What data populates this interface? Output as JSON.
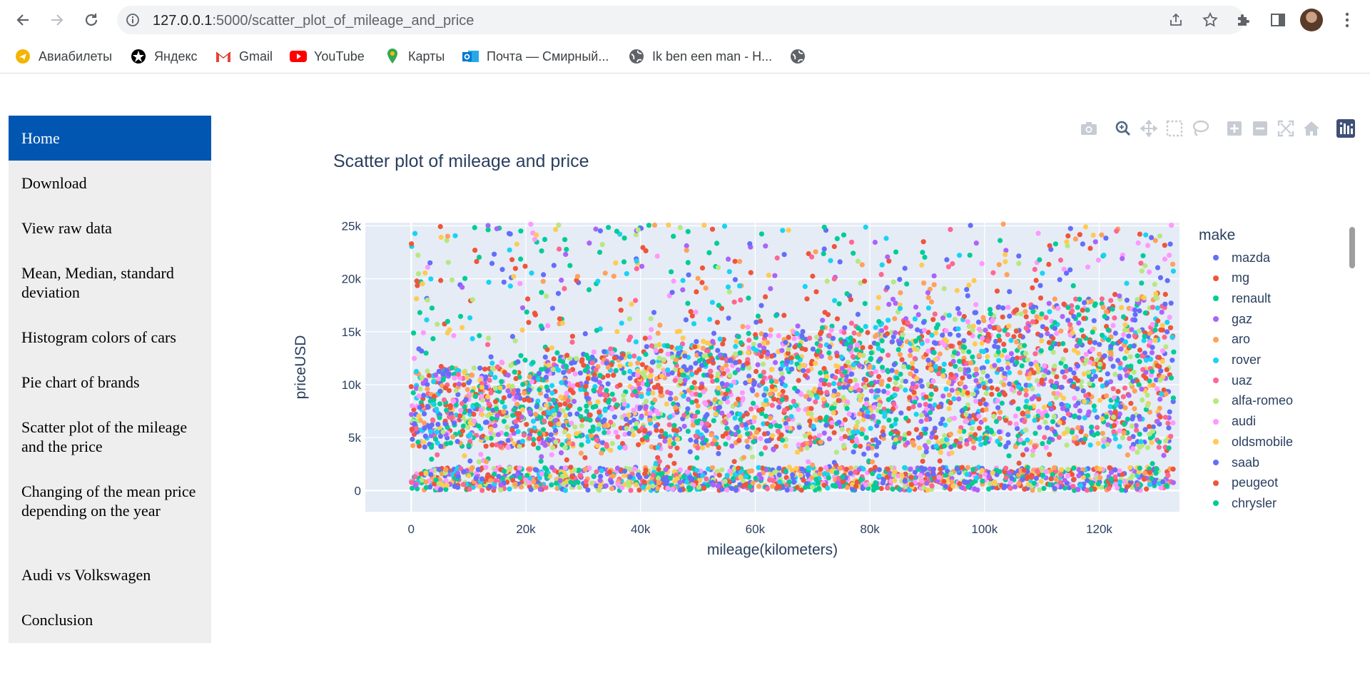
{
  "browser": {
    "url_host": "127.0.0.1",
    "url_path": ":5000/scatter_plot_of_mileage_and_price",
    "bookmarks": [
      {
        "label": "Авиабилеты",
        "icon": "plane-bookmark-icon",
        "color": "#f4b400"
      },
      {
        "label": "Яндекс",
        "icon": "yandex-icon",
        "color": "#000000"
      },
      {
        "label": "Gmail",
        "icon": "gmail-icon",
        "color": "#ea4335"
      },
      {
        "label": "YouTube",
        "icon": "youtube-icon",
        "color": "#ff0000"
      },
      {
        "label": "Карты",
        "icon": "maps-icon",
        "color": "#34a853"
      },
      {
        "label": "Почта — Смирный...",
        "icon": "outlook-icon",
        "color": "#0078d4"
      },
      {
        "label": "Ik ben een man - H...",
        "icon": "globe-icon",
        "color": "#5f6368"
      },
      {
        "label": "",
        "icon": "globe-icon",
        "color": "#5f6368"
      }
    ]
  },
  "sidebar": {
    "items": [
      {
        "label": "Home",
        "active": true
      },
      {
        "label": "Download",
        "active": false
      },
      {
        "label": "View raw data",
        "active": false
      },
      {
        "label": "Mean, Median, standard deviation",
        "active": false
      },
      {
        "label": "Histogram colors of cars",
        "active": false
      },
      {
        "label": "Pie chart of brands",
        "active": false
      },
      {
        "label": "Scatter plot of the mileage and the price",
        "active": false
      },
      {
        "label": "Changing of the mean price depending on the year",
        "active": false
      },
      {
        "label": "Audi vs Volkswagen",
        "active": false
      },
      {
        "label": "Conclusion",
        "active": false
      }
    ]
  },
  "modebar": [
    "camera-icon",
    "zoom-icon",
    "pan-icon",
    "box-select-icon",
    "lasso-select-icon",
    "zoom-in-icon",
    "zoom-out-icon",
    "autoscale-icon",
    "reset-axes-icon",
    "plotly-logo-icon"
  ],
  "chart_data": {
    "type": "scatter",
    "title": "Scatter plot of mileage and price",
    "xlabel": "mileage(kilometers)",
    "ylabel": "priceUSD",
    "xlim": [
      -8000,
      134000
    ],
    "ylim": [
      -2000,
      25300
    ],
    "x_ticks": [
      0,
      20000,
      40000,
      60000,
      80000,
      100000,
      120000
    ],
    "x_tick_labels": [
      "0",
      "20k",
      "40k",
      "60k",
      "80k",
      "100k",
      "120k"
    ],
    "y_ticks": [
      0,
      5000,
      10000,
      15000,
      20000,
      25000
    ],
    "y_tick_labels": [
      "0",
      "5k",
      "10k",
      "15k",
      "20k",
      "25k"
    ],
    "grid": true,
    "plot_bgcolor": "#e5ecf6",
    "legend_title": "make",
    "legend_position": "right",
    "series": [
      {
        "name": "mazda",
        "color": "#636efa"
      },
      {
        "name": "mg",
        "color": "#ef553b"
      },
      {
        "name": "renault",
        "color": "#00cc96"
      },
      {
        "name": "gaz",
        "color": "#ab63fa"
      },
      {
        "name": "aro",
        "color": "#ffa15a"
      },
      {
        "name": "rover",
        "color": "#19d3f3"
      },
      {
        "name": "uaz",
        "color": "#ff6692"
      },
      {
        "name": "alfa-romeo",
        "color": "#b6e880"
      },
      {
        "name": "audi",
        "color": "#ff97ff"
      },
      {
        "name": "oldsmobile",
        "color": "#fecb52"
      },
      {
        "name": "saab",
        "color": "#636efa"
      },
      {
        "name": "peugeot",
        "color": "#ef553b"
      },
      {
        "name": "chrysler",
        "color": "#00cc96"
      }
    ]
  }
}
